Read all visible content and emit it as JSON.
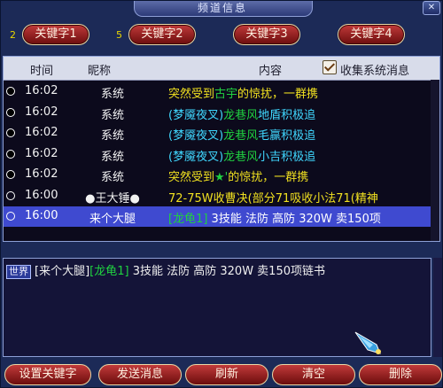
{
  "window": {
    "title": "频道信息",
    "close": "✕"
  },
  "keywords": [
    {
      "num": "2",
      "label": "关键字1"
    },
    {
      "num": "5",
      "label": "关键字2"
    },
    {
      "num": "",
      "label": "关键字3"
    },
    {
      "num": "",
      "label": "关键字4"
    }
  ],
  "list": {
    "headers": {
      "time": "时间",
      "name": "昵称",
      "content": "内容",
      "collect": "收集系统消息"
    },
    "collect_checked": true,
    "rows": [
      {
        "dot": "filled",
        "time": "16:02",
        "name": "系统",
        "parts": [
          {
            "t": "突然受到",
            "c": "c-yellow"
          },
          {
            "t": "古宇",
            "c": "c-green"
          },
          {
            "t": "​",
            "c": "c-yellow"
          },
          {
            "t": "的惊扰，一群携",
            "c": "c-yellow"
          }
        ]
      },
      {
        "dot": "filled",
        "time": "16:02",
        "name": "系统",
        "parts": [
          {
            "t": "(梦魇夜叉)",
            "c": "c-cyan"
          },
          {
            "t": "龙巷风",
            "c": "c-green"
          },
          {
            "t": "地盾积极追",
            "c": "c-cyan"
          }
        ]
      },
      {
        "dot": "filled",
        "time": "16:02",
        "name": "系统",
        "parts": [
          {
            "t": "(梦魇夜叉)",
            "c": "c-cyan"
          },
          {
            "t": "龙巷风",
            "c": "c-green"
          },
          {
            "t": "毛赢积极追",
            "c": "c-cyan"
          }
        ]
      },
      {
        "dot": "filled",
        "time": "16:02",
        "name": "系统",
        "parts": [
          {
            "t": "(梦魇夜叉)",
            "c": "c-cyan"
          },
          {
            "t": "龙巷风",
            "c": "c-green"
          },
          {
            "t": "小吉积极追",
            "c": "c-cyan"
          }
        ]
      },
      {
        "dot": "filled",
        "time": "16:02",
        "name": "系统",
        "parts": [
          {
            "t": "突然受到",
            "c": "c-yellow"
          },
          {
            "t": "★'",
            "c": "c-green"
          },
          {
            "t": "的惊扰，一群携",
            "c": "c-yellow"
          }
        ]
      },
      {
        "dot": "hollow",
        "time": "16:00",
        "name": "●王大锤●",
        "parts": [
          {
            "t": "72-75W收曹决(部分71吸收小法71(精神",
            "c": "c-yellow"
          }
        ]
      },
      {
        "dot": "hollow",
        "time": "16:00",
        "name": "来个大腿",
        "selected": true,
        "parts": [
          {
            "t": "[龙龟1]",
            "c": "c-green"
          },
          {
            "t": " 3技能 法防 高防 320W 卖150项",
            "c": "c-white"
          }
        ]
      }
    ]
  },
  "chat": {
    "channel": "世界",
    "sender": "[来个大腿]",
    "tag": "[龙龟1]",
    "text": " 3技能 法防 高防 320W 卖150项链书"
  },
  "buttons": {
    "set_keyword": "设置关键字",
    "send": "发送消息",
    "refresh": "刷新",
    "clear": "清空",
    "delete": "删除"
  },
  "colors": {
    "window_bg": "#1c2a57",
    "button_red": "#b02a2a",
    "selected_row": "#3f4ad0",
    "header_bg": "#d8dcea"
  }
}
